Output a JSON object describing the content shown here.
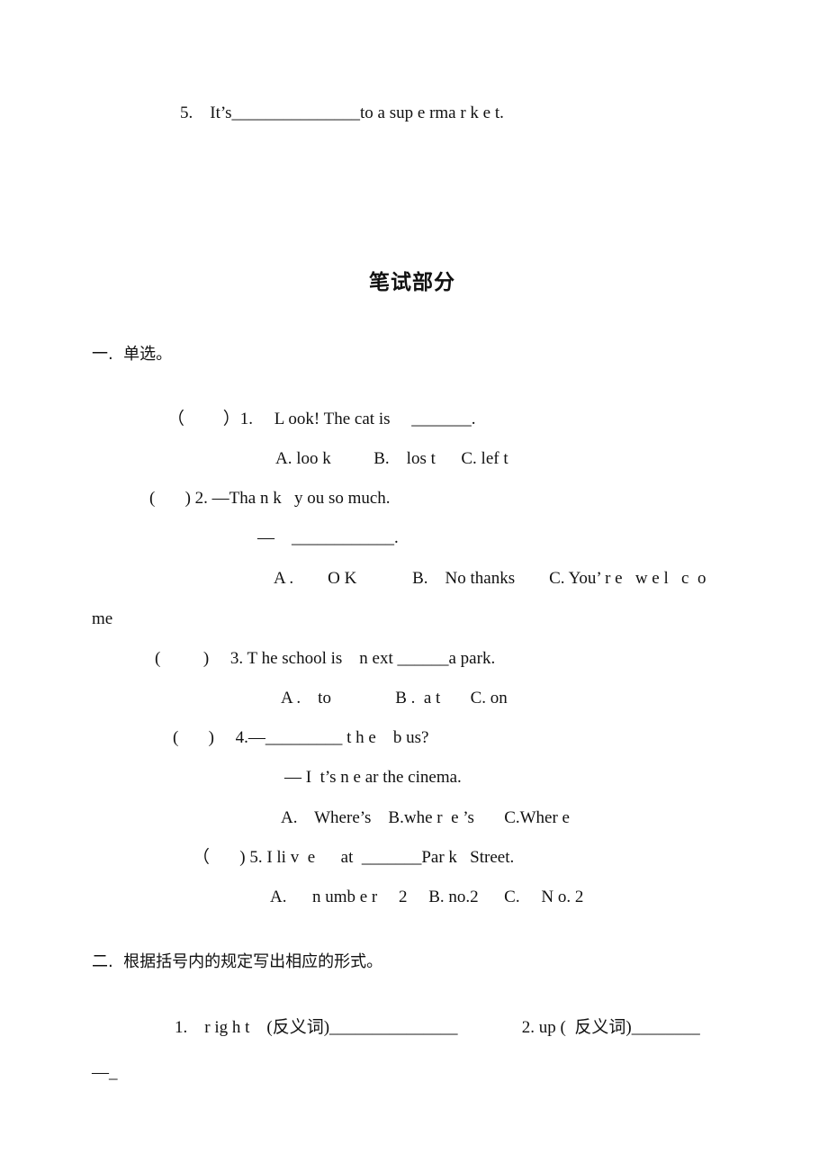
{
  "listening_tail": {
    "item5": "5.    It’s_______________to a sup e rma r k e t."
  },
  "section_title": "笔试部分",
  "part1": {
    "heading": "一.  单选。",
    "questions": [
      {
        "stem": "（         ）1.     L ook! The cat is     _______.",
        "options": "A. loo k          B.    los t      C. lef t"
      },
      {
        "stem": "(       ) 2. —Tha n k   y ou so much.",
        "stem_line2": "—    ____________.",
        "options": "A .        O K             B.    No thanks        C. You’ r e   w e l   c  o",
        "options_wrap": "me"
      },
      {
        "stem": "(          )     3. T he school is    n ext ______a park.",
        "options": "A .    to               B .  a t       C. on"
      },
      {
        "stem": "(       )     4.—_________ t h e    b us?",
        "stem_line2": "— I  t’s n e ar the cinema.",
        "options": "A.    Where’s    B.whe r  e ’s       C.Wher e"
      },
      {
        "stem": "（       ) 5. I li v  e      at  _______Par k   Street.",
        "options": "A.      n umb e r     2     B. no.2      C.     N o. 2"
      }
    ]
  },
  "part2": {
    "heading": "二.  根据括号内的规定写出相应的形式。",
    "items_line1": "1.    r ig h t    (反义词)_______________               2. up (  反义词)________",
    "items_line2": "—_"
  }
}
